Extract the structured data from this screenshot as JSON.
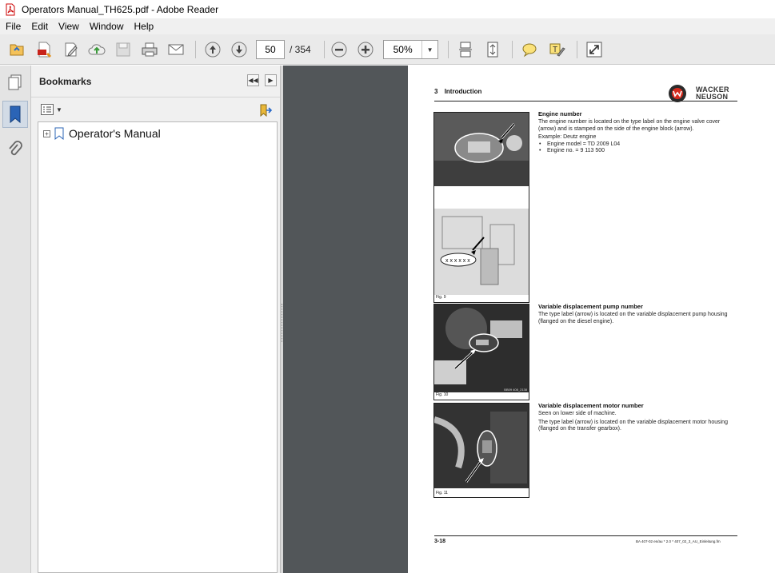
{
  "window": {
    "title": "Operators Manual_TH625.pdf - Adobe Reader"
  },
  "menu": [
    "File",
    "Edit",
    "View",
    "Window",
    "Help"
  ],
  "toolbar": {
    "current_page": "50",
    "page_total": "/ 354",
    "zoom": "50%",
    "icons": [
      "open-icon",
      "create-pdf-icon",
      "edit-icon",
      "cloud-upload-icon",
      "save-icon",
      "print-icon",
      "email-icon",
      "previous-page-icon",
      "next-page-icon",
      "zoom-out-icon",
      "zoom-in-icon",
      "scrolling-mode-icon",
      "fit-page-icon",
      "comment-icon",
      "highlight-icon",
      "fullscreen-icon"
    ]
  },
  "side_rail": {
    "icons": [
      "pages-icon",
      "bookmarks-icon",
      "attachments-icon"
    ]
  },
  "bookmarks": {
    "header": "Bookmarks",
    "items": [
      {
        "label": "Operator's Manual",
        "expander": "+"
      }
    ]
  },
  "page": {
    "section_number": "3",
    "section_title": "Introduction",
    "brand_line1": "WACKER",
    "brand_line2": "NEUSON",
    "figures": [
      {
        "caption": "Fig. 9",
        "code": ""
      },
      {
        "caption": "Fig. 10",
        "code": "BB09 408_2138"
      },
      {
        "caption": "Fig. 11",
        "code": ""
      }
    ],
    "sections": [
      {
        "title": "Engine number",
        "paragraphs": [
          "The engine number is located on the type label on the engine valve cover (arrow) and is stamped on the side of the engine block (arrow).",
          "Example: Deutz engine"
        ],
        "bullets": [
          "Engine model = TD 2009 L04",
          "Engine no. = 9 113 500"
        ]
      },
      {
        "title": "Variable displacement pump number",
        "paragraphs": [
          "The type label (arrow) is located on the variable displacement pump housing (flanged on the diesel engine)."
        ],
        "bullets": []
      },
      {
        "title": "Variable displacement motor number",
        "paragraphs": [
          "Seen on lower side of machine.",
          "The type label (arrow) is located on the variable displacement motor housing (flanged on the transfer gearbox)."
        ],
        "bullets": []
      }
    ],
    "footer_left": "3-18",
    "footer_right": "BA 407-02 en/au * 2.0 * 407_02_3_AU_Einleitung.fm"
  }
}
